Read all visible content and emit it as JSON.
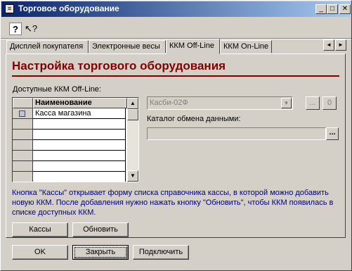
{
  "window": {
    "title": "Торговое оборудование",
    "icon": "window-icon",
    "controls": {
      "minimize": "_",
      "maximize": "□",
      "close": "✕"
    }
  },
  "toolbar": {
    "help_glyph": "?",
    "whatsthis_glyph": "↖?"
  },
  "tabs": [
    {
      "label": "Дисплей покупателя",
      "active": false
    },
    {
      "label": "Электронные весы",
      "active": false
    },
    {
      "label": "ККМ Off-Line",
      "active": true
    },
    {
      "label": "ККМ On-Line",
      "active": false
    }
  ],
  "tab_scroll": {
    "left": "◄",
    "right": "►"
  },
  "panel": {
    "heading": "Настройка торгового оборудования",
    "available_label": "Доступные ККМ Off-Line:",
    "grid": {
      "column_header": "Наименование",
      "rows": [
        "Касса магазина",
        "",
        "",
        "",
        "",
        "",
        ""
      ]
    },
    "scroll": {
      "up": "▲",
      "down": "▼"
    },
    "device_select": {
      "value": "Касби-02Ф",
      "arrow": "▼"
    },
    "device_buttons": {
      "settings": "...",
      "clear": "0"
    },
    "catalog_label": "Каталог обмена данными:",
    "catalog_value": "",
    "catalog_browse": "...",
    "info_text": "Кнопка \"Кассы\" открывает форму списка справочника кассы, в которой можно добавить новую ККМ. После добавления нужно нажать кнопку \"Обновить\", чтобы ККМ появилась в списке доступных ККМ.",
    "buttons": {
      "registers": "Кассы",
      "refresh": "Обновить"
    }
  },
  "footer": {
    "ok": "OK",
    "close": "Закрыть",
    "connect": "Подключить"
  }
}
